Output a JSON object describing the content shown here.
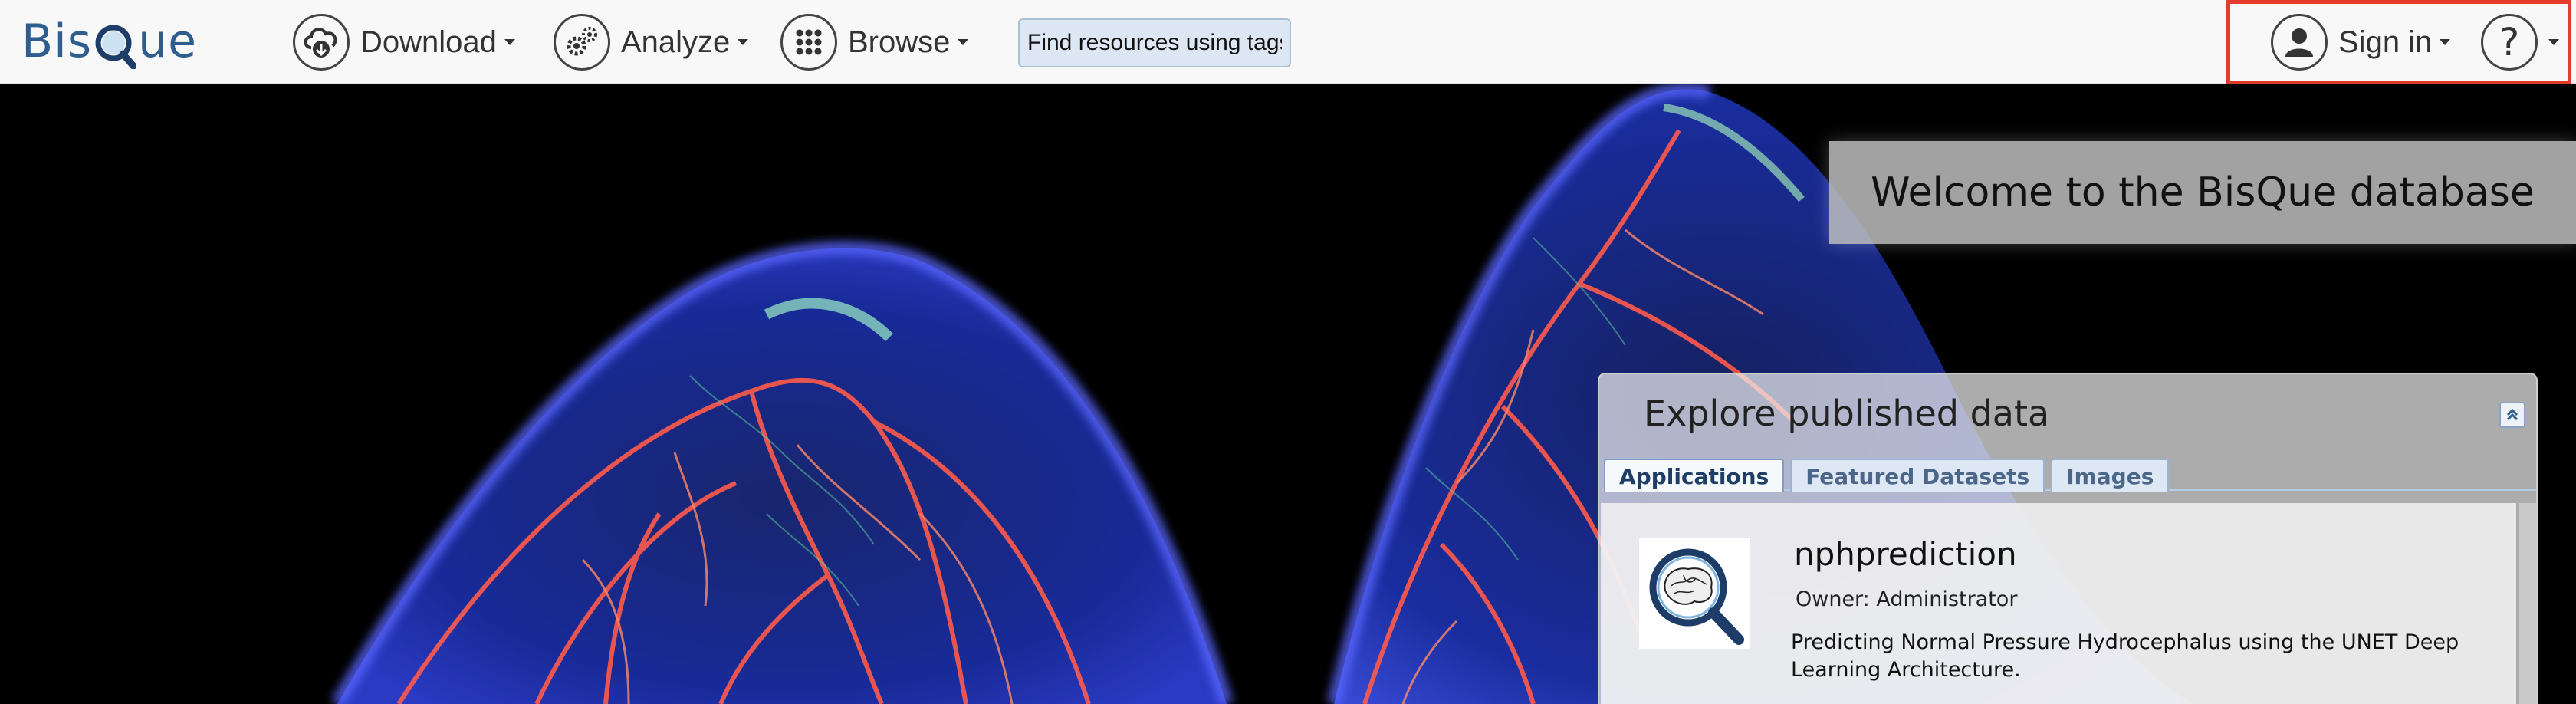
{
  "brand": {
    "prefix": "Bis",
    "suffix": "ue"
  },
  "nav": {
    "download": "Download",
    "analyze": "Analyze",
    "browse": "Browse",
    "signin": "Sign in"
  },
  "search": {
    "placeholder": "Find resources using tags"
  },
  "hero": {
    "welcome": "Welcome to the BisQue database"
  },
  "explore": {
    "title": "Explore published data",
    "tabs": [
      "Applications",
      "Featured Datasets",
      "Images"
    ],
    "active_tab": "Applications",
    "app": {
      "name": "nphprediction",
      "owner": "Owner: Administrator",
      "description": "Predicting Normal Pressure Hydrocephalus using the UNET Deep Learning Architecture."
    }
  },
  "icons": {
    "download": "cloud-download-icon",
    "analyze": "gears-icon",
    "browse": "grid-icon",
    "signin": "user-icon",
    "help": "question-icon",
    "collapse": "double-chevron-up-icon"
  },
  "colors": {
    "brand": "#2d5e8e",
    "highlight": "#e53b2d",
    "tab_text": "#4b6688",
    "search_bg": "#dde7f3"
  }
}
